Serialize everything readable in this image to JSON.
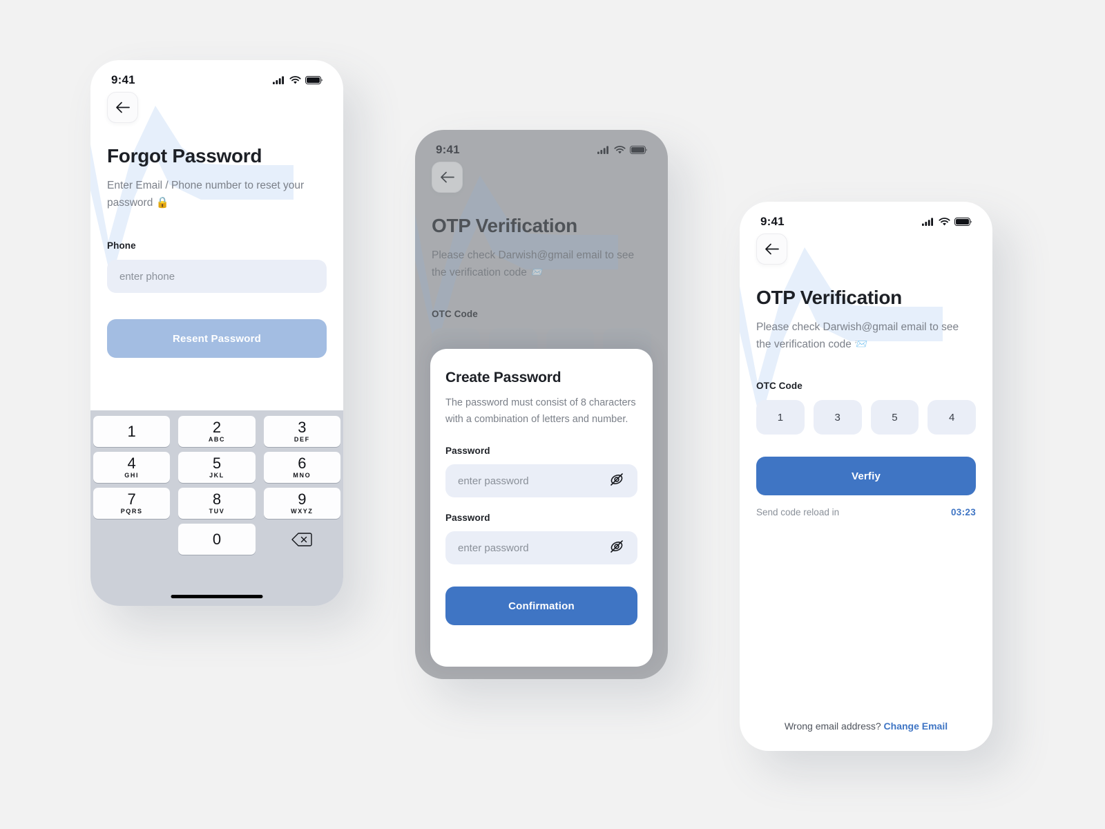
{
  "screens": {
    "forgot_password": {
      "status": {
        "time": "9:41"
      },
      "back_icon": "arrow-left-icon",
      "title": "Forgot Password",
      "subtitle": "Enter Email / Phone number to reset your password 🔒",
      "phone_label": "Phone",
      "phone_placeholder": "enter phone",
      "submit_label": "Resent Password",
      "keypad": {
        "keys": [
          {
            "num": "1",
            "alpha": ""
          },
          {
            "num": "2",
            "alpha": "ABC"
          },
          {
            "num": "3",
            "alpha": "DEF"
          },
          {
            "num": "4",
            "alpha": "GHI"
          },
          {
            "num": "5",
            "alpha": "JKL"
          },
          {
            "num": "6",
            "alpha": "MNO"
          },
          {
            "num": "7",
            "alpha": "PQRS"
          },
          {
            "num": "8",
            "alpha": "TUV"
          },
          {
            "num": "9",
            "alpha": "WXYZ"
          },
          {
            "num": "0",
            "alpha": ""
          }
        ],
        "backspace_icon": "backspace-icon"
      }
    },
    "otp_with_modal": {
      "status": {
        "time": "9:41"
      },
      "back_icon": "arrow-left-icon",
      "title": "OTP Verification",
      "subtitle": "Please check Darwish@gmail email to see the verification code 📨",
      "otc_label": "OTC Code",
      "otc_values": [
        "",
        "",
        "",
        ""
      ],
      "modal": {
        "title": "Create Password",
        "description": "The password must consist of 8 characters with a combination of letters and number.",
        "password_label_1": "Password",
        "password_placeholder_1": "enter password",
        "password_label_2": "Password",
        "password_placeholder_2": "enter password",
        "toggle_icon": "eye-off-icon",
        "submit_label": "Confirmation"
      }
    },
    "otp_verification": {
      "status": {
        "time": "9:41"
      },
      "back_icon": "arrow-left-icon",
      "title": "OTP Verification",
      "subtitle": "Please check Darwish@gmail email to see the verification code 📨",
      "otc_label": "OTC Code",
      "otc_values": [
        "1",
        "3",
        "5",
        "4"
      ],
      "verify_label": "Verfiy",
      "resend_label": "Send code reload in",
      "resend_timer": "03:23",
      "footer_text": "Wrong email address?",
      "footer_link": "Change Email"
    }
  },
  "colors": {
    "accent_blue": "#3f75c4",
    "muted_blue": "#a3bde2",
    "field_bg": "#eaeef7",
    "page_bg": "#f2f2f2",
    "keypad_bg": "#ccd0d8"
  }
}
